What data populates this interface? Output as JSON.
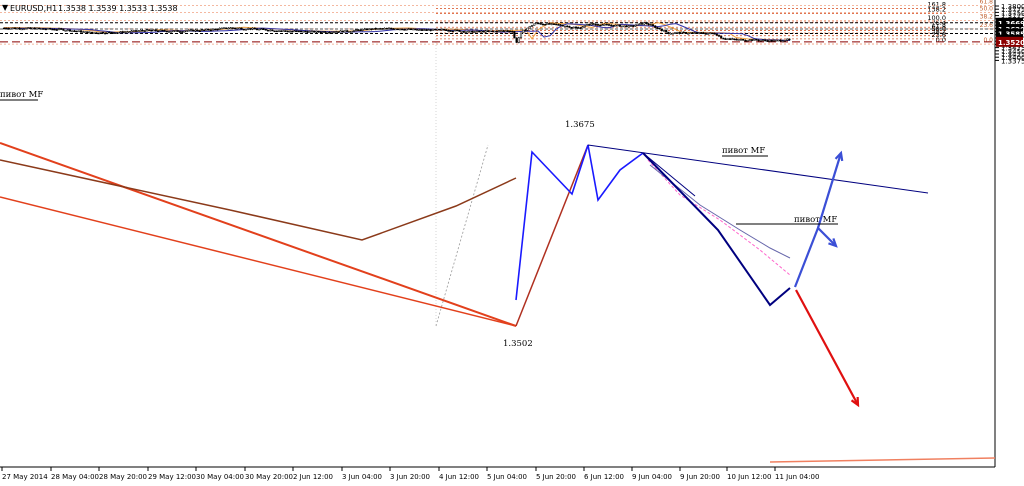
{
  "header": {
    "title": "EURUSD,H1",
    "ohlc": "1.3538 1.3539 1.3533 1.3538"
  },
  "chart_data": {
    "type": "candlestick",
    "symbol": "EURUSD",
    "timeframe": "H1",
    "ylim": [
      1.3375,
      1.3805
    ],
    "price_ticks": [
      "1.3800",
      "1.3775",
      "1.3750",
      "1.3725",
      "1.3700",
      "1.3675",
      "1.3650",
      "1.3625",
      "1.3600",
      "1.3575",
      "1.3550",
      "1.3525",
      "1.3500",
      "1.3475",
      "1.3450",
      "1.3425",
      "1.3400",
      "1.3375"
    ],
    "time_ticks": [
      "27 May 2014",
      "28 May 04:00",
      "28 May 20:00",
      "29 May 12:00",
      "30 May 04:00",
      "30 May 20:00",
      "2 Jun 12:00",
      "3 Jun 04:00",
      "3 Jun 20:00",
      "4 Jun 12:00",
      "5 Jun 04:00",
      "5 Jun 20:00",
      "6 Jun 12:00",
      "9 Jun 04:00",
      "9 Jun 20:00",
      "10 Jun 12:00",
      "11 Jun 04:00"
    ],
    "price_labels": [
      {
        "text": "1.3669",
        "value": 1.3669,
        "color": "#000000"
      },
      {
        "text": "1.3620",
        "value": 1.362,
        "color": "#000000"
      },
      {
        "text": "1.3585",
        "value": 1.3585,
        "color": "#000000"
      },
      {
        "text": "1.3538",
        "value": 1.3538,
        "color": "#000000"
      },
      {
        "text": "1.3520",
        "value": 1.352,
        "color": "#8b0000"
      }
    ],
    "horizontal_lines": [
      {
        "value": 1.3669,
        "color": "#000000",
        "style": "dashed"
      },
      {
        "value": 1.362,
        "color": "#555555",
        "style": "dashed"
      },
      {
        "value": 1.3585,
        "color": "#000000",
        "style": "dashed"
      },
      {
        "value": 1.352,
        "color": "#8b0000",
        "style": "dashed"
      }
    ],
    "fib_levels": [
      {
        "label": "161.8",
        "value": 1.378
      },
      {
        "label": "138.2",
        "value": 1.3742
      },
      {
        "label": "100.0",
        "value": 1.3675
      },
      {
        "label": "76.4",
        "value": 1.3634
      },
      {
        "label": "61.8",
        "value": 1.3609
      },
      {
        "label": "50.0",
        "value": 1.3589
      },
      {
        "label": "38.2",
        "value": 1.3568
      },
      {
        "label": "23.6",
        "value": 1.3543
      },
      {
        "label": "0.0",
        "value": 1.3502
      }
    ],
    "fib_right_labels": [
      {
        "label": "61.8",
        "value": 1.3805
      },
      {
        "label": "50.0",
        "value": 1.375
      },
      {
        "label": "38.2",
        "value": 1.3686
      },
      {
        "label": "23.6",
        "value": 1.3621
      },
      {
        "label": "0.0",
        "value": 1.3502
      }
    ],
    "annotations": [
      {
        "text": "1.3675",
        "kind": "high"
      },
      {
        "text": "1.3502",
        "kind": "low"
      },
      {
        "text": "пивот MF",
        "kind": "pivot-left"
      },
      {
        "text": "пивот MF",
        "kind": "pivot-top"
      },
      {
        "text": "пивот MF",
        "kind": "pivot-right"
      }
    ],
    "colors": {
      "candles": "#000000",
      "fib": "#cc3300",
      "trend_red": "#e2401c",
      "trend_brown": "#8b3a1a",
      "wave_blue": "#1a1aff",
      "wave_navy": "#00007f",
      "ma_orange": "#f0a040",
      "ma_navy": "#3333aa",
      "ma_pink": "#ff66cc",
      "arrow_blue": "#3b4fd6",
      "arrow_red": "#e01010"
    }
  }
}
